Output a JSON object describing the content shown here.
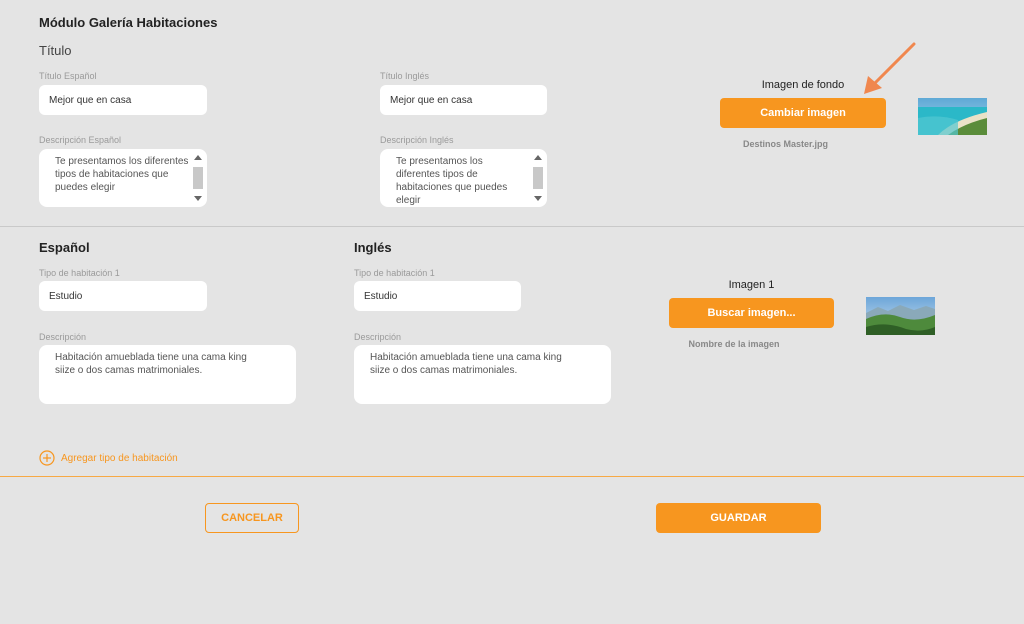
{
  "module": {
    "title": "Módulo Galería Habitaciones",
    "subtitle": "Título"
  },
  "header_fields": {
    "title_es": {
      "label": "Título Español",
      "value": "Mejor que en casa"
    },
    "title_en": {
      "label": "Título Inglés",
      "value": "Mejor que en casa"
    },
    "desc_es": {
      "label": "Descripción Español",
      "value": "Te presentamos los diferentes tipos de habitaciones que puedes elegir"
    },
    "desc_en": {
      "label": "Descripción Inglés",
      "value": "Te presentamos los diferentes tipos de habitaciones que puedes elegir"
    }
  },
  "background_image": {
    "caption": "Imagen de fondo",
    "button": "Cambiar imagen",
    "filename": "Destinos Master.jpg"
  },
  "rooms": {
    "es_heading": "Español",
    "en_heading": "Inglés",
    "es": {
      "type_label": "Tipo de habitación 1",
      "type_value": "Estudio",
      "desc_label": "Descripción",
      "desc_value": "Habitación amueblada tiene una cama king siize o dos camas matrimoniales."
    },
    "en": {
      "type_label": "Tipo de habitación 1",
      "type_value": "Estudio",
      "desc_label": "Descripción",
      "desc_value": "Habitación amueblada tiene una cama king siize o dos camas matrimoniales."
    },
    "image": {
      "caption": "Imagen 1",
      "button": "Buscar imagen...",
      "filename": "Nombre de la imagen"
    },
    "add_label": "Agregar tipo de habitación"
  },
  "footer": {
    "cancel": "CANCELAR",
    "save": "GUARDAR"
  },
  "colors": {
    "accent": "#f7961f",
    "background": "#e4e4e4"
  },
  "icons": {
    "add": "plus-circle-icon",
    "annotation": "arrow-annotation-icon"
  }
}
